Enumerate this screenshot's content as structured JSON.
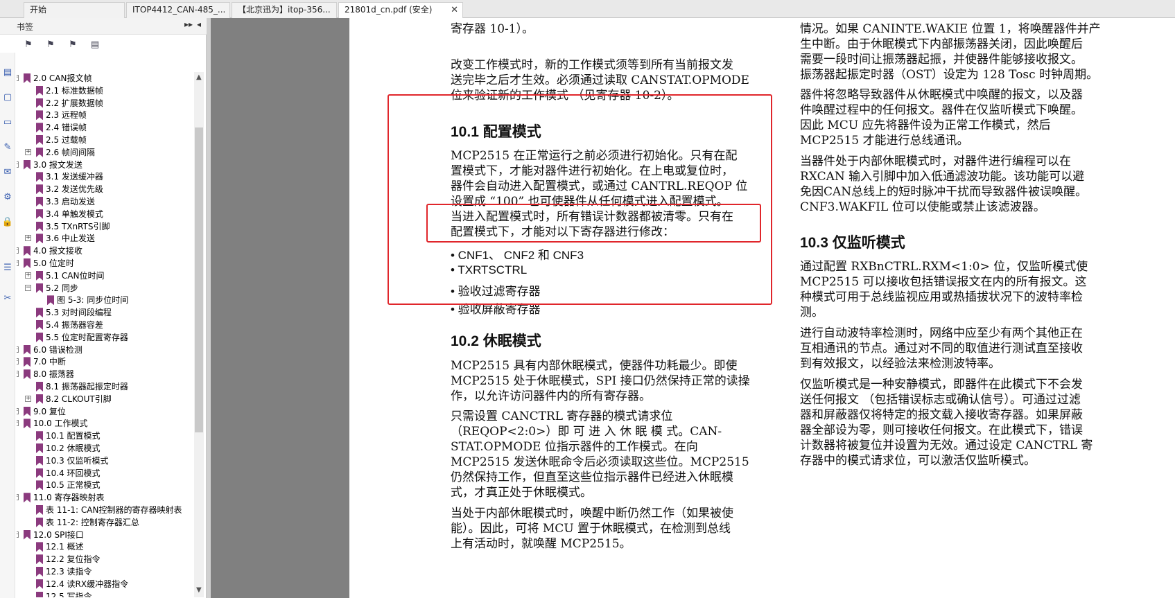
{
  "tabs": [
    {
      "label": "开始"
    },
    {
      "label": "ITOP4412_CAN-485_..."
    },
    {
      "label": "【北京迅为】itop-356..."
    },
    {
      "label": "21801d_cn.pdf (安全)"
    }
  ],
  "tab_close": "✕",
  "sidebar": {
    "title": "书签",
    "expand_btn": "▸▸",
    "collapse_btn": "◂",
    "tools": [
      "⚑",
      "⚑",
      "⚑",
      "▤"
    ],
    "strip_icons": [
      "▤",
      "▢",
      "▭",
      "✎",
      "✉",
      "⚙",
      "🔒",
      "☰",
      "✂"
    ],
    "tree": [
      {
        "label": "2.0 CAN报文帧",
        "lvl": 0,
        "exp": "−"
      },
      {
        "label": "2.1 标准数据帧",
        "lvl": 1
      },
      {
        "label": "2.2 扩展数据帧",
        "lvl": 1
      },
      {
        "label": "2.3 远程帧",
        "lvl": 1
      },
      {
        "label": "2.4 错误帧",
        "lvl": 1
      },
      {
        "label": "2.5 过载帧",
        "lvl": 1
      },
      {
        "label": "2.6 帧间间隔",
        "lvl": 1,
        "exp": "+"
      },
      {
        "label": "3.0 报文发送",
        "lvl": 0,
        "exp": "−"
      },
      {
        "label": "3.1 发送缓冲器",
        "lvl": 1
      },
      {
        "label": "3.2 发送优先级",
        "lvl": 1
      },
      {
        "label": "3.3 启动发送",
        "lvl": 1
      },
      {
        "label": "3.4 单触发模式",
        "lvl": 1
      },
      {
        "label": "3.5 TXnRTS引脚",
        "lvl": 1
      },
      {
        "label": "3.6 中止发送",
        "lvl": 1,
        "exp": "+"
      },
      {
        "label": "4.0 报文接收",
        "lvl": 0,
        "exp": "+"
      },
      {
        "label": "5.0 位定时",
        "lvl": 0,
        "exp": "−"
      },
      {
        "label": "5.1 CAN位时间",
        "lvl": 1,
        "exp": "+"
      },
      {
        "label": "5.2 同步",
        "lvl": 1,
        "exp": "−"
      },
      {
        "label": "图 5-3:   同步位时间",
        "lvl": 2
      },
      {
        "label": "5.3 对时间段编程",
        "lvl": 1
      },
      {
        "label": "5.4 振荡器容差",
        "lvl": 1
      },
      {
        "label": "5.5 位定时配置寄存器",
        "lvl": 1
      },
      {
        "label": "6.0 错误检测",
        "lvl": 0,
        "exp": "+"
      },
      {
        "label": "7.0 中断",
        "lvl": 0,
        "exp": "+"
      },
      {
        "label": "8.0 振荡器",
        "lvl": 0,
        "exp": "−"
      },
      {
        "label": "8.1 振荡器起振定时器",
        "lvl": 1
      },
      {
        "label": "8.2 CLKOUT引脚",
        "lvl": 1,
        "exp": "+"
      },
      {
        "label": "9.0 复位",
        "lvl": 0,
        "exp": "+"
      },
      {
        "label": "10.0 工作模式",
        "lvl": 0,
        "exp": "−"
      },
      {
        "label": "10.1 配置模式",
        "lvl": 1
      },
      {
        "label": "10.2 休眠模式",
        "lvl": 1
      },
      {
        "label": "10.3 仅监听模式",
        "lvl": 1
      },
      {
        "label": "10.4 环回模式",
        "lvl": 1
      },
      {
        "label": "10.5 正常模式",
        "lvl": 1
      },
      {
        "label": "11.0 寄存器映射表",
        "lvl": 0,
        "exp": "−"
      },
      {
        "label": "表 11-1:   CAN控制器的寄存器映射表",
        "lvl": 1
      },
      {
        "label": "表 11-2:   控制寄存器汇总",
        "lvl": 1
      },
      {
        "label": "12.0 SPI接口",
        "lvl": 0,
        "exp": "−"
      },
      {
        "label": "12.1 概述",
        "lvl": 1
      },
      {
        "label": "12.2 复位指令",
        "lvl": 1
      },
      {
        "label": "12.3 读指令",
        "lvl": 1
      },
      {
        "label": "12.4 读RX缓冲器指令",
        "lvl": 1
      },
      {
        "label": "12.5 写指令",
        "lvl": 1
      }
    ]
  },
  "pdf": {
    "col1": {
      "intro": [
        "寄存器 10-1）。"
      ],
      "para_change": [
        "改变工作模式时，新的工作模式须等到所有当前报文发",
        "送完毕之后才生效。必须通过读取 CANSTAT.OPMODE",
        "位来验证新的工作模式 （见寄存器  10-2）。"
      ],
      "h101": "10.1      配置模式",
      "para101": [
        "MCP2515 在正常运行之前必须进行初始化。只有在配",
        "置模式下，才能对器件进行初始化。在上电或复位时，",
        "器件会自动进入配置模式，或通过 CANTRL.REQOP 位",
        "设置成 “100” 也可使器件从任何模式进入配置模式。",
        "当进入配置模式时，所有错误计数器都被清零。只有在",
        "配置模式下，才能对以下寄存器进行修改："
      ],
      "bullets": [
        "•  CNF1、 CNF2 和 CNF3",
        "•  TXRTSCTRL",
        "•  验收过滤寄存器",
        "•  验收屏蔽寄存器"
      ],
      "h102": "10.2      休眠模式",
      "para102a": [
        "MCP2515 具有内部休眠模式，使器件功耗最少。即使",
        "MCP2515 处于休眠模式，SPI 接口仍然保持正常的读操",
        "作，以允许访问器件内的所有寄存器。"
      ],
      "para102b": [
        "只需设置         CANCTRL         寄存器的模式请求位",
        "（REQOP<2:0>）即 可 进 入 休 眠 模 式。CAN-",
        "STAT.OPMODE          位指示器件的工作模式。在向",
        "MCP2515 发送休眠命令后必须读取这些位。MCP2515",
        "仍然保持工作，但直至这些位指示器件已经进入休眠模",
        "式，才真正处于休眠模式。"
      ],
      "para102c": [
        "当处于内部休眠模式时，唤醒中断仍然工作（如果被使",
        "能）。因此，可将  MCU  置于休眠模式，在检测到总线",
        "上有活动时，就唤醒 MCP2515。"
      ]
    },
    "col2": {
      "paraA": [
        "情况。如果 CANINTE.WAKIE 位置 1，将唤醒器件并产",
        "生中断。由于休眠模式下内部振荡器关闭，因此唤醒后",
        "需要一段时间让振荡器起振，并使器件能够接收报文。",
        "振荡器起振定时器（OST）设定为 128 Tosc 时钟周期。"
      ],
      "paraB": [
        "器件将忽略导致器件从休眠模式中唤醒的报文，以及器",
        "件唤醒过程中的任何报文。器件在仅监听模式下唤醒。",
        "因此      MCU      应先将器件设为正常工作模式，然后",
        "MCP2515 才能进行总线通讯。"
      ],
      "paraC": [
        "当器件处于内部休眠模式时，对器件进行编程可以在",
        "RXCAN 输入引脚中加入低通滤波功能。该功能可以避",
        "免因CAN总线上的短时脉冲干扰而导致器件被误唤醒。",
        "CNF3.WAKFIL 位可以使能或禁止该滤波器。"
      ],
      "h103": "10.3      仅监听模式",
      "paraD": [
        "通过配置  RXBnCTRL.RXM<1:0>  位，仅监听模式使",
        "MCP2515 可以接收包括错误报文在内的所有报文。这",
        "种模式可用于总线监视应用或热插拔状况下的波特率检",
        "测。"
      ],
      "paraE": [
        "进行自动波特率检测时，网络中应至少有两个其他正在",
        "互相通讯的节点。通过对不同的取值进行测试直至接收",
        "到有效报文，以经验法来检测波特率。"
      ],
      "paraF": [
        "仅监听模式是一种安静模式，即器件在此模式下不会发",
        "送任何报文 （包括错误标志或确认信号）。可通过过滤",
        "器和屏蔽器仅将特定的报文载入接收寄存器。如果屏蔽",
        "器全部设为零，则可接收任何报文。在此模式下，错误",
        "计数器将被复位并设置为无效。通过设定 CANCTRL 寄",
        "存器中的模式请求位，可以激活仅监听模式。"
      ]
    }
  },
  "colors": {
    "highlight_box": "#e0262b",
    "bookmark": "#8b3a7e"
  }
}
